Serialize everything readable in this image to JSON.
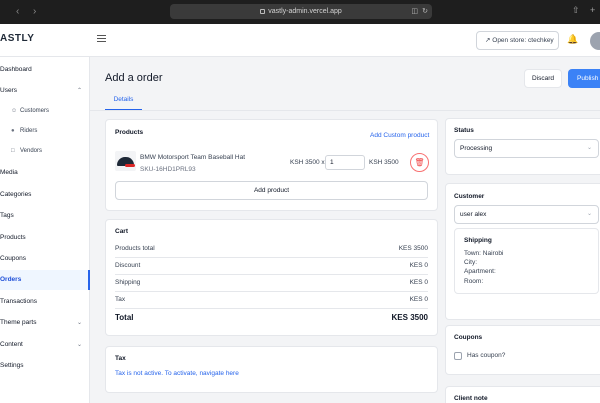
{
  "browser": {
    "url": "vastly-admin.vercel.app",
    "back_icon": "chevron-left-icon",
    "forward_icon": "chevron-right-icon"
  },
  "topbar": {
    "brand": "ASTLY",
    "open_store_label": "Open store: ctechkey"
  },
  "sidebar": {
    "items": [
      {
        "label": "Dashboard"
      },
      {
        "label": "Users"
      },
      {
        "label": "Customers"
      },
      {
        "label": "Riders"
      },
      {
        "label": "Vendors"
      },
      {
        "label": "Media"
      },
      {
        "label": "Categories"
      },
      {
        "label": "Tags"
      },
      {
        "label": "Products"
      },
      {
        "label": "Coupons"
      },
      {
        "label": "Orders"
      },
      {
        "label": "Transactions"
      },
      {
        "label": "Theme parts"
      },
      {
        "label": "Content"
      },
      {
        "label": "Settings"
      }
    ]
  },
  "page": {
    "title": "Add a order",
    "discard_label": "Discard",
    "publish_label": "Publish",
    "tab_details": "Details"
  },
  "products": {
    "heading": "Products",
    "add_custom_label": "Add Custom product",
    "item": {
      "name": "BMW Motorsport Team Baseball Hat",
      "sku": "SKU-16HD1PRL93",
      "unit_price": "KSH 3500 x",
      "quantity": "1",
      "line_total": "KSH 3500"
    },
    "add_product_label": "Add product"
  },
  "cart": {
    "heading": "Cart",
    "rows": [
      {
        "label": "Products total",
        "value": "KES 3500"
      },
      {
        "label": "Discount",
        "value": "KES 0"
      },
      {
        "label": "Shipping",
        "value": "KES 0"
      },
      {
        "label": "Tax",
        "value": "KES 0"
      }
    ],
    "total_label": "Total",
    "total_value": "KES 3500"
  },
  "tax": {
    "heading": "Tax",
    "message": "Tax is not active. To activate,",
    "link": "navigate here"
  },
  "status": {
    "heading": "Status",
    "value": "Processing"
  },
  "customer": {
    "heading": "Customer",
    "value": "user alex",
    "shipping_heading": "Shipping",
    "town": "Town: Nairobi",
    "city": "City:",
    "apartment": "Apartment:",
    "room": "Room:"
  },
  "coupons": {
    "heading": "Coupons",
    "has_coupon_label": "Has coupon?"
  },
  "client_note": {
    "heading": "Client note"
  },
  "colors": {
    "primary": "#3b82f6",
    "danger": "#ef4444"
  }
}
